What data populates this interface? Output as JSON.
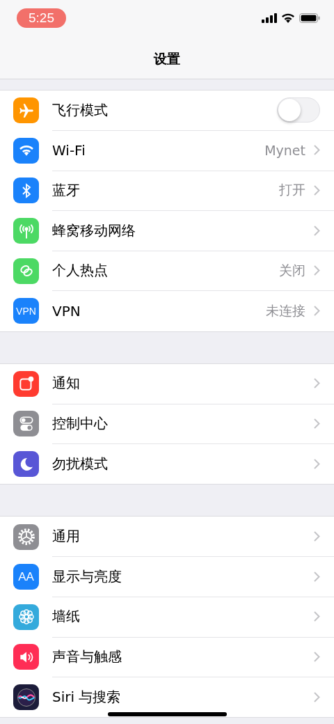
{
  "status_bar": {
    "time": "5:25"
  },
  "nav": {
    "title": "设置"
  },
  "groups": [
    {
      "rows": [
        {
          "label": "飞行模式",
          "kind": "toggle",
          "on": false
        },
        {
          "label": "Wi-Fi",
          "kind": "link",
          "value": "Mynet"
        },
        {
          "label": "蓝牙",
          "kind": "link",
          "value": "打开"
        },
        {
          "label": "蜂窝移动网络",
          "kind": "link"
        },
        {
          "label": "个人热点",
          "kind": "link",
          "value": "关闭"
        },
        {
          "icon_text": "VPN",
          "label": "VPN",
          "kind": "link",
          "value": "未连接"
        }
      ]
    },
    {
      "rows": [
        {
          "label": "通知",
          "kind": "link"
        },
        {
          "label": "控制中心",
          "kind": "link"
        },
        {
          "label": "勿扰模式",
          "kind": "link"
        }
      ]
    },
    {
      "rows": [
        {
          "label": "通用",
          "kind": "link"
        },
        {
          "icon_text": "AA",
          "label": "显示与亮度",
          "kind": "link"
        },
        {
          "label": "墙纸",
          "kind": "link"
        },
        {
          "label": "声音与触感",
          "kind": "link"
        },
        {
          "label": "Siri 与搜索",
          "kind": "link"
        }
      ]
    }
  ]
}
